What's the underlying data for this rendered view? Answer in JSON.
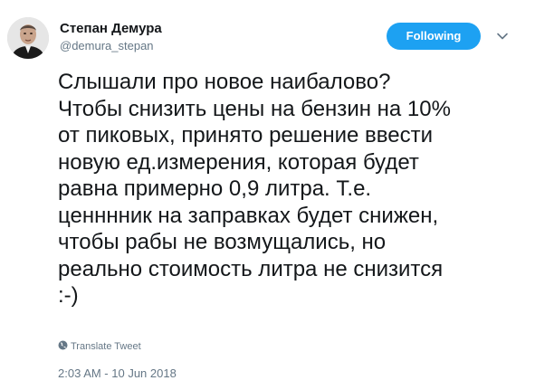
{
  "author": {
    "name": "Степан Демура",
    "handle": "@demura_stepan"
  },
  "follow_button": {
    "label": "Following"
  },
  "tweet": {
    "text": "Слышали про новое наибалово?\nЧтобы снизить цены на бензин на 10%\nот пиковых, принято решение ввести\nновую ед.измерения, которая будет\nравна примерно 0,9 литра. Т.е.\nценннник на заправках будет снижен,\nчтобы рабы не возмущались, но\nреально стоимость литра не снизится\n:-)",
    "translate_label": "Translate Tweet",
    "timestamp": "2:03 AM - 10 Jun 2018"
  },
  "icons": {
    "avatar": "avatar-photo",
    "menu": "chevron-down-icon",
    "translate": "globe-icon"
  },
  "colors": {
    "accent": "#1da1f2",
    "text": "#14171a",
    "secondary": "#657786"
  }
}
